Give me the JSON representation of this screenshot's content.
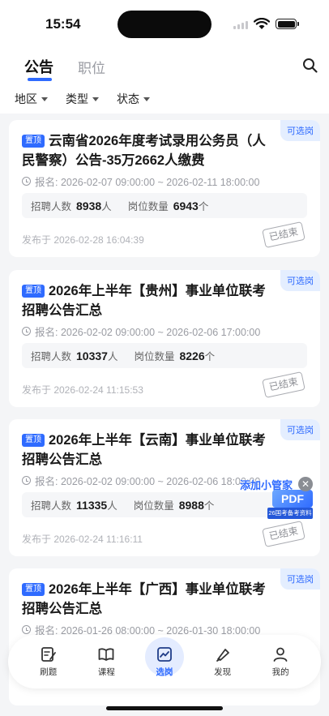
{
  "status_bar": {
    "time": "15:54"
  },
  "header": {
    "tabs": [
      {
        "label": "公告",
        "active": true
      },
      {
        "label": "职位",
        "active": false
      }
    ]
  },
  "filters": [
    {
      "label": "地区"
    },
    {
      "label": "类型"
    },
    {
      "label": "状态"
    }
  ],
  "cards": [
    {
      "tag": "可选岗",
      "pin": "置顶",
      "title": "云南省2026年度考试录用公务员（人民警察）公告-35万2662人缴费",
      "date": "报名: 2026-02-07 09:00:00 ~ 2026-02-11 18:00:00",
      "recruit_label": "招聘人数",
      "recruit_value": "8938",
      "recruit_unit": "人",
      "posts_label": "岗位数量",
      "posts_value": "6943",
      "posts_unit": "个",
      "posted": "发布于 2026-02-28 16:04:39",
      "stamp": "已结束"
    },
    {
      "tag": "可选岗",
      "pin": "置顶",
      "title": "2026年上半年【贵州】事业单位联考招聘公告汇总",
      "date": "报名: 2026-02-02 09:00:00 ~ 2026-02-06 17:00:00",
      "recruit_label": "招聘人数",
      "recruit_value": "10337",
      "recruit_unit": "人",
      "posts_label": "岗位数量",
      "posts_value": "8226",
      "posts_unit": "个",
      "posted": "发布于 2026-02-24 11:15:53",
      "stamp": "已结束"
    },
    {
      "tag": "可选岗",
      "pin": "置顶",
      "title": "2026年上半年【云南】事业单位联考招聘公告汇总",
      "date": "报名: 2026-02-02 09:00:00 ~ 2026-02-06 18:00:00",
      "recruit_label": "招聘人数",
      "recruit_value": "11335",
      "recruit_unit": "人",
      "posts_label": "岗位数量",
      "posts_value": "8988",
      "posts_unit": "个",
      "posted": "发布于 2026-02-24 11:16:11",
      "stamp": "已结束"
    },
    {
      "tag": "可选岗",
      "pin": "置顶",
      "title": "2026年上半年【广西】事业单位联考招聘公告汇总",
      "date": "报名: 2026-01-26 08:00:00 ~ 2026-01-30 18:00:00"
    }
  ],
  "floating_ad": {
    "text": "添加小管家",
    "badge": "PDF",
    "sub": "26国考备考资料",
    "close": "✕"
  },
  "bottom_nav": [
    {
      "label": "刷题",
      "icon": "practice-icon",
      "active": false
    },
    {
      "label": "课程",
      "icon": "book-icon",
      "active": false
    },
    {
      "label": "选岗",
      "icon": "chart-icon",
      "active": true
    },
    {
      "label": "发现",
      "icon": "discover-icon",
      "active": false
    },
    {
      "label": "我的",
      "icon": "user-icon",
      "active": false
    }
  ],
  "colors": {
    "accent": "#2f6bff",
    "tag_bg": "#e4eeff",
    "page_bg": "#f4f5f7"
  }
}
